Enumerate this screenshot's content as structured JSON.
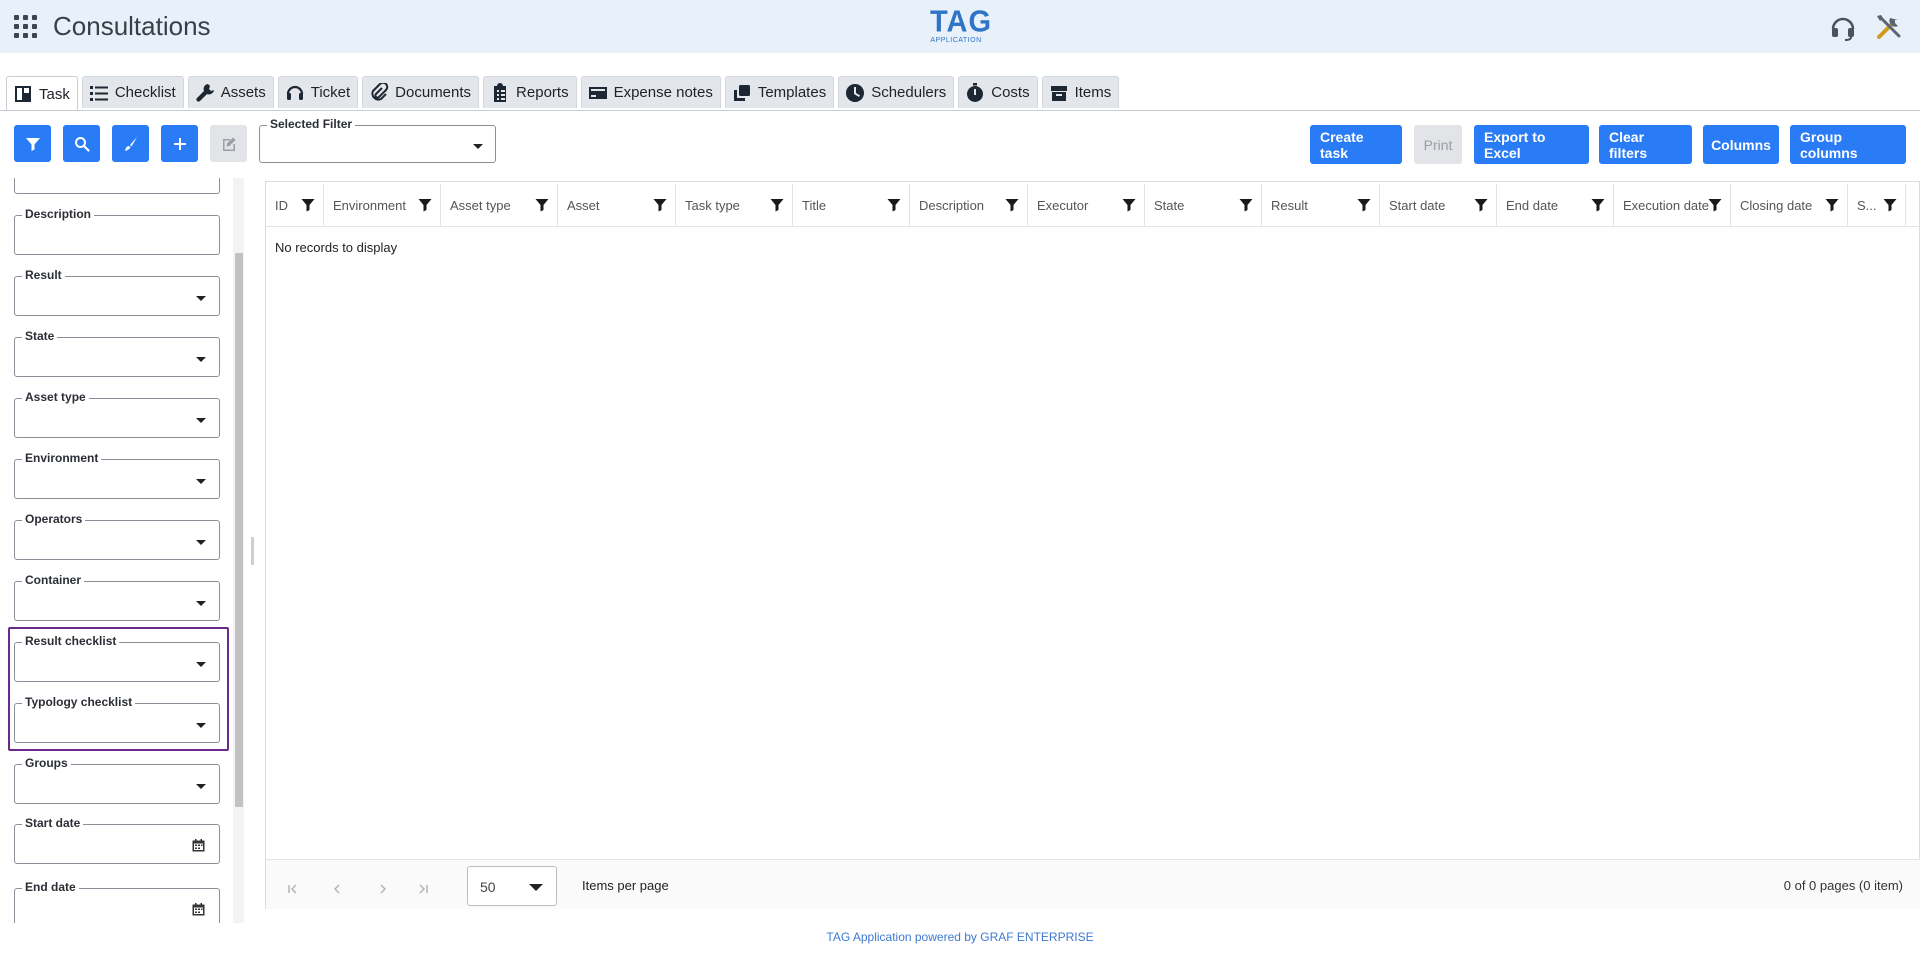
{
  "header": {
    "title": "Consultations",
    "logo_main": "TAG",
    "logo_sub": "APPLICATION"
  },
  "tabs": [
    {
      "label": "Task",
      "icon": "board-icon",
      "active": true
    },
    {
      "label": "Checklist",
      "icon": "list-icon"
    },
    {
      "label": "Assets",
      "icon": "wrench-icon"
    },
    {
      "label": "Ticket",
      "icon": "headset-icon"
    },
    {
      "label": "Documents",
      "icon": "paperclip-icon"
    },
    {
      "label": "Reports",
      "icon": "clipboard-icon"
    },
    {
      "label": "Expense notes",
      "icon": "card-icon"
    },
    {
      "label": "Templates",
      "icon": "copy-icon"
    },
    {
      "label": "Schedulers",
      "icon": "clock-icon"
    },
    {
      "label": "Costs",
      "icon": "stopwatch-icon"
    },
    {
      "label": "Items",
      "icon": "box-icon"
    }
  ],
  "toolbar": {
    "selected_filter_label": "Selected Filter",
    "selected_filter_value": "",
    "buttons": [
      "Create task",
      "Print",
      "Export to Excel",
      "Clear filters",
      "Columns",
      "Group columns"
    ]
  },
  "filters": [
    {
      "label": "Description",
      "type": "text"
    },
    {
      "label": "Result",
      "type": "select"
    },
    {
      "label": "State",
      "type": "select"
    },
    {
      "label": "Asset type",
      "type": "select"
    },
    {
      "label": "Environment",
      "type": "select"
    },
    {
      "label": "Operators",
      "type": "select"
    },
    {
      "label": "Container",
      "type": "select"
    },
    {
      "label": "Result checklist",
      "type": "select"
    },
    {
      "label": "Typology checklist",
      "type": "select"
    },
    {
      "label": "Groups",
      "type": "select"
    },
    {
      "label": "Start date",
      "type": "date"
    },
    {
      "label": "End date",
      "type": "date"
    }
  ],
  "grid": {
    "columns": [
      "ID",
      "Environment",
      "Asset type",
      "Asset",
      "Task type",
      "Title",
      "Description",
      "Executor",
      "State",
      "Result",
      "Start date",
      "End date",
      "Execution date",
      "Closing date",
      "S..."
    ],
    "empty_text": "No records to display",
    "page_size": "50",
    "items_per_page_label": "Items per page",
    "page_info": "0 of 0 pages (0 item)"
  },
  "footer": {
    "text": "TAG Application powered by GRAF ENTERPRISE"
  },
  "colors": {
    "accent": "#2a7cf6",
    "topbar": "#e8f0fa",
    "highlight": "#6a2a8a",
    "footer_link": "#3d7ad1"
  }
}
